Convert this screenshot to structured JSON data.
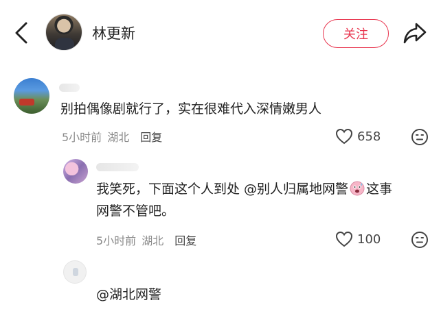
{
  "header": {
    "username": "林更新",
    "follow_label": "关注"
  },
  "comments": [
    {
      "text": "别拍偶像剧就行了，实在很难代入深情嫩男人",
      "time": "5小时前",
      "location": "湖北",
      "reply_label": "回复",
      "likes": "658"
    },
    {
      "text_before_emoji": "我笑死，下面这个人到处 @别人归属地网警",
      "text_after_emoji": "这事",
      "text_line2": "网警不管吧。",
      "time": "5小时前",
      "location": "湖北",
      "reply_label": "回复",
      "likes": "100"
    },
    {
      "text": "@湖北网警"
    }
  ],
  "icons": {
    "back": "chevron-left-icon",
    "share": "share-arrow-icon",
    "like": "heart-outline-icon",
    "emoji": "emoji-face-icon",
    "inline_emoji": "surprised-sweat-emoji"
  },
  "colors": {
    "accent": "#e8364f",
    "text": "#222222",
    "meta": "#8a8a8a"
  }
}
